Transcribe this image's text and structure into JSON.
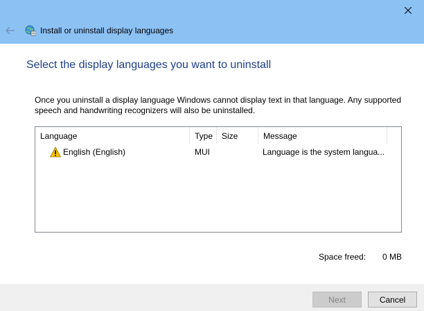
{
  "window": {
    "title": "Install or uninstall display languages",
    "icons": {
      "back": "back-arrow-icon",
      "app": "language-globe-icon",
      "close": "close-icon"
    }
  },
  "main": {
    "heading": "Select the display languages you want to uninstall",
    "description": "Once you uninstall a display language Windows cannot display text in that language. Any supported speech and handwriting recognizers will also be uninstalled."
  },
  "list": {
    "columns": [
      "Language",
      "Type",
      "Size",
      "Message"
    ],
    "rows": [
      {
        "icon": "warning-icon",
        "language": "English (English)",
        "type": "MUI",
        "size": "",
        "message": "Language is the system langua..."
      }
    ]
  },
  "summary": {
    "label": "Space freed:",
    "value": "0 MB"
  },
  "buttons": {
    "next": "Next",
    "cancel": "Cancel"
  },
  "colors": {
    "titlebar": "#8cc1f4",
    "heading": "#1e3f8a",
    "warning": "#f2c200"
  }
}
